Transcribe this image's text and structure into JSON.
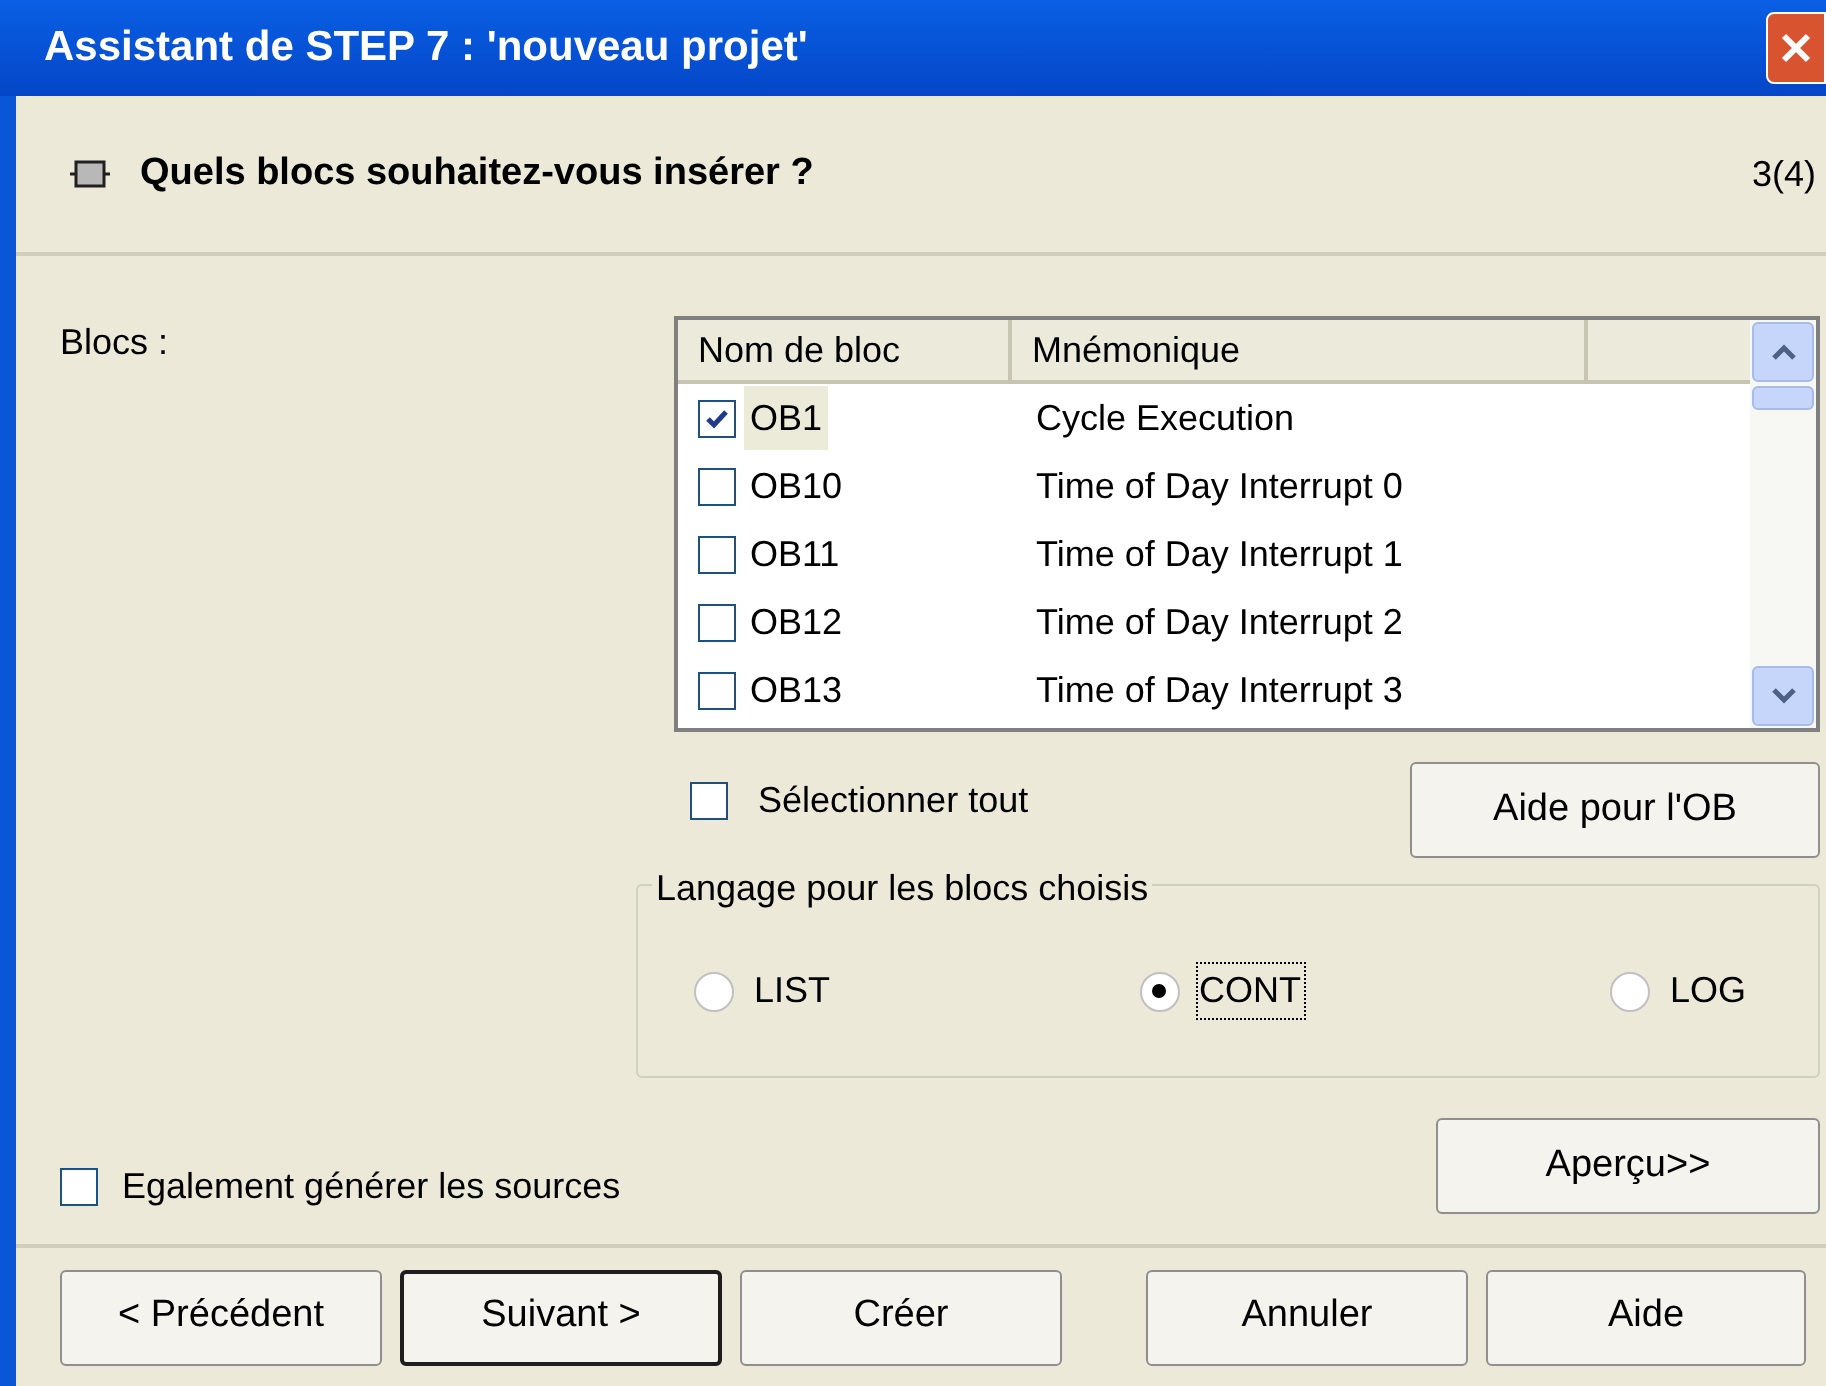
{
  "window": {
    "title": "Assistant de STEP 7 : 'nouveau projet'"
  },
  "header": {
    "title": "Quels blocs souhaitez-vous insérer ?",
    "step": "3(4)"
  },
  "blocks_label": "Blocs :",
  "table": {
    "columns": [
      "Nom de bloc",
      "Mnémonique"
    ],
    "rows": [
      {
        "checked": true,
        "selected": true,
        "name": "OB1",
        "mnemonic": "Cycle Execution"
      },
      {
        "checked": false,
        "selected": false,
        "name": "OB10",
        "mnemonic": "Time of Day Interrupt 0"
      },
      {
        "checked": false,
        "selected": false,
        "name": "OB11",
        "mnemonic": "Time of Day Interrupt 1"
      },
      {
        "checked": false,
        "selected": false,
        "name": "OB12",
        "mnemonic": "Time of Day Interrupt 2"
      },
      {
        "checked": false,
        "selected": false,
        "name": "OB13",
        "mnemonic": "Time of Day Interrupt 3"
      }
    ]
  },
  "select_all": {
    "label": "Sélectionner tout",
    "checked": false
  },
  "ob_help_button": "Aide pour l'OB",
  "language_group": {
    "legend": "Langage pour les blocs choisis",
    "options": [
      {
        "label": "LIST",
        "selected": false
      },
      {
        "label": "CONT",
        "selected": true
      },
      {
        "label": "LOG",
        "selected": false
      }
    ]
  },
  "generate_sources": {
    "label": "Egalement générer les sources",
    "checked": false
  },
  "preview_button": "Aperçu>>",
  "buttons": [
    {
      "label": "< Précédent",
      "default": false
    },
    {
      "label": "Suivant >",
      "default": true
    },
    {
      "label": "Créer",
      "default": false
    },
    {
      "label": "Annuler",
      "default": false
    },
    {
      "label": "Aide",
      "default": false
    }
  ]
}
